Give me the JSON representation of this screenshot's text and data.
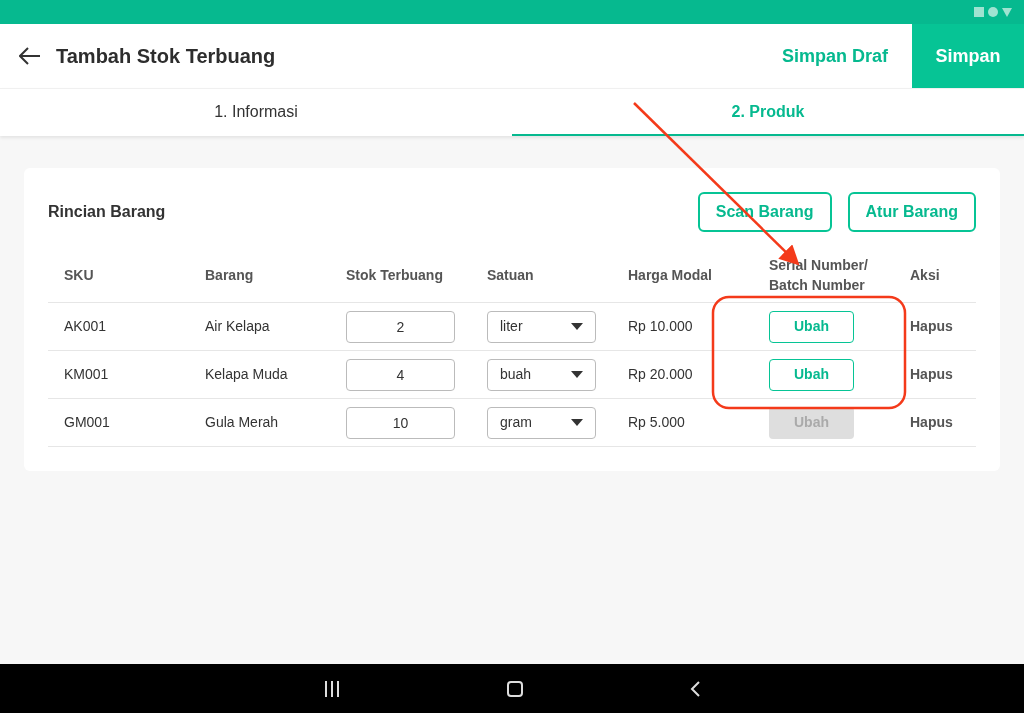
{
  "header": {
    "title": "Tambah Stok Terbuang",
    "draft_button": "Simpan Draf",
    "save_button": "Simpan"
  },
  "tabs": [
    {
      "label": "1. Informasi",
      "selected": false
    },
    {
      "label": "2. Produk",
      "selected": true
    }
  ],
  "card": {
    "title": "Rincian Barang",
    "buttons": [
      "Scan Barang",
      "Atur Barang"
    ]
  },
  "table": {
    "columns": [
      "SKU",
      "Barang",
      "Stok Terbuang",
      "Satuan",
      "Harga Modal",
      "Serial Number/ Batch Number",
      "Aksi"
    ],
    "rows": [
      {
        "sku": "AK001",
        "name": "Air Kelapa",
        "qty": "2",
        "unit": "liter",
        "price": "Rp 10.000",
        "serial_button": "Ubah",
        "serial_disabled": false,
        "action": "Hapus"
      },
      {
        "sku": "KM001",
        "name": "Kelapa Muda",
        "qty": "4",
        "unit": "buah",
        "price": "Rp 20.000",
        "serial_button": "Ubah",
        "serial_disabled": false,
        "action": "Hapus"
      },
      {
        "sku": "GM001",
        "name": "Gula Merah",
        "qty": "10",
        "unit": "gram",
        "price": "Rp 5.000",
        "serial_button": "Ubah",
        "serial_disabled": true,
        "action": "Hapus"
      }
    ]
  }
}
